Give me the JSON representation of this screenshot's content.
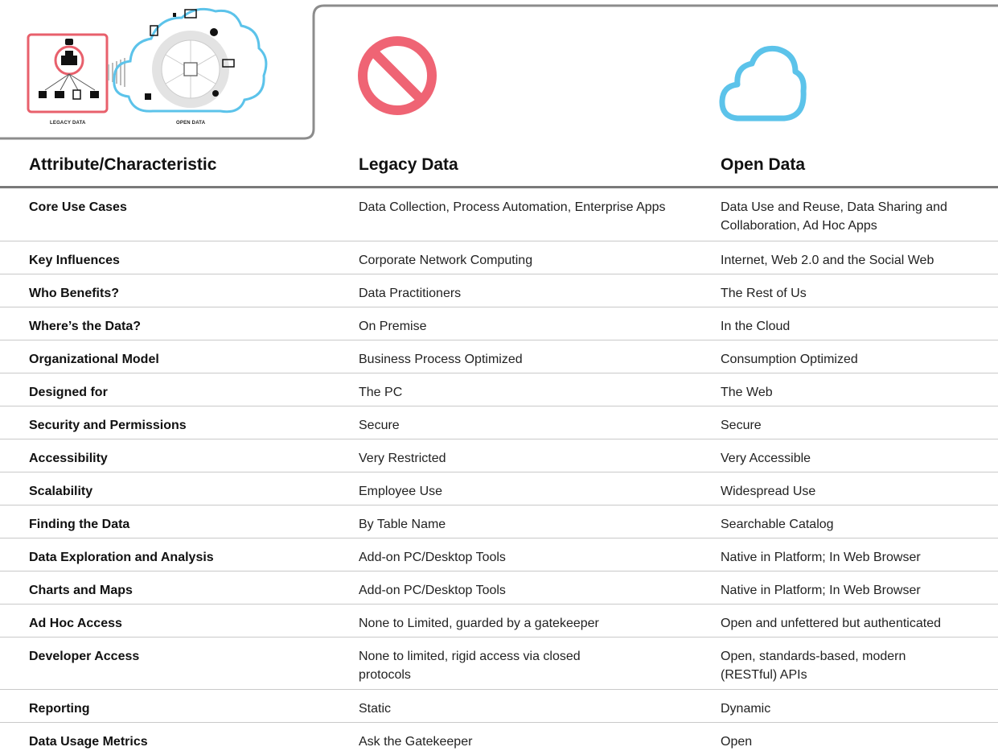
{
  "diagram": {
    "legacy_caption": "LEGACY DATA",
    "open_caption": "OPEN DATA",
    "colors": {
      "legacy": "#e8606c",
      "open": "#5cc3ea",
      "frame": "#8c8c8c"
    }
  },
  "icons": {
    "legacy_icon": "prohibited-icon",
    "open_icon": "cloud-icon",
    "legacy_color": "#ef6474",
    "open_color": "#5cc3ea"
  },
  "table": {
    "headers": [
      "Attribute/Characteristic",
      "Legacy Data",
      "Open Data"
    ],
    "rows": [
      [
        "Core Use Cases",
        "Data Collection, Process Automation, Enterprise Apps",
        "Data Use and Reuse, Data Sharing and Collaboration, Ad Hoc Apps"
      ],
      [
        "Key Influences",
        "Corporate Network Computing",
        "Internet, Web 2.0 and the Social Web"
      ],
      [
        "Who Benefits?",
        "Data Practitioners",
        "The Rest of Us"
      ],
      [
        "Where’s the Data?",
        "On Premise",
        "In the Cloud"
      ],
      [
        "Organizational Model",
        "Business Process Optimized",
        "Consumption Optimized"
      ],
      [
        "Designed for",
        "The PC",
        "The Web"
      ],
      [
        "Security and Permissions",
        "Secure",
        "Secure"
      ],
      [
        "Accessibility",
        "Very Restricted",
        "Very Accessible"
      ],
      [
        "Scalability",
        "Employee Use",
        "Widespread Use"
      ],
      [
        "Finding the Data",
        "By Table Name",
        "Searchable Catalog"
      ],
      [
        "Data Exploration and Analysis",
        "Add-on PC/Desktop Tools",
        "Native in Platform; In Web Browser"
      ],
      [
        "Charts and Maps",
        "Add-on PC/Desktop Tools",
        "Native in Platform; In Web Browser"
      ],
      [
        "Ad Hoc Access",
        "None to Limited, guarded by a gatekeeper",
        "Open and unfettered but authenticated"
      ],
      [
        "Developer Access",
        "None to limited, rigid access via closed protocols",
        "Open, standards-based, modern (RESTful) APIs"
      ],
      [
        "Reporting",
        "Static",
        "Dynamic"
      ],
      [
        "Data Usage Metrics",
        "Ask the Gatekeeper",
        "Open"
      ]
    ]
  }
}
